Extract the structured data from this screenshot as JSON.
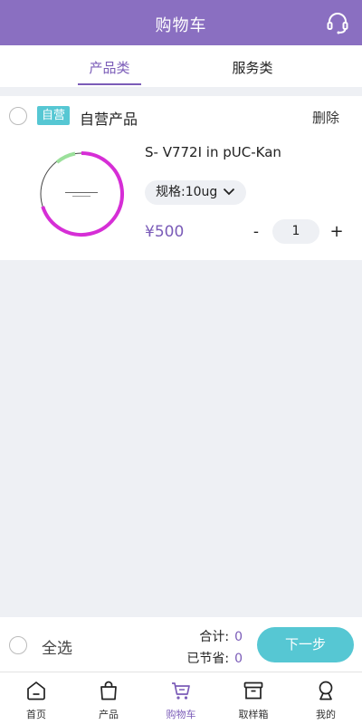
{
  "header": {
    "title": "购物车",
    "service_icon": "headset-icon"
  },
  "tabs": [
    {
      "label": "产品类",
      "active": true
    },
    {
      "label": "服务类",
      "active": false
    }
  ],
  "cart": {
    "group": {
      "tag": "自营",
      "title": "自营产品",
      "delete_label": "删除"
    },
    "items": [
      {
        "name": "S- V772I in pUC-Kan",
        "spec": "规格:10ug",
        "price": "¥500",
        "quantity": "1",
        "minus": "-",
        "plus": "+"
      }
    ]
  },
  "checkout": {
    "select_all": "全选",
    "total_label": "合计:",
    "total_value": "0",
    "saved_label": "已节省:",
    "saved_value": "0",
    "next_label": "下一步"
  },
  "tabbar": [
    {
      "label": "首页",
      "icon": "home-icon",
      "active": false
    },
    {
      "label": "产品",
      "icon": "bag-icon",
      "active": false
    },
    {
      "label": "购物车",
      "icon": "cart-icon",
      "active": true
    },
    {
      "label": "取样箱",
      "icon": "box-icon",
      "active": false
    },
    {
      "label": "我的",
      "icon": "user-icon",
      "active": false
    }
  ],
  "colors": {
    "primary": "#8a6fc1",
    "accent_purple": "#7b5cb8",
    "teal": "#56c7d3",
    "plasmid_ring": "#d62ed6",
    "background": "#eef0f4"
  }
}
